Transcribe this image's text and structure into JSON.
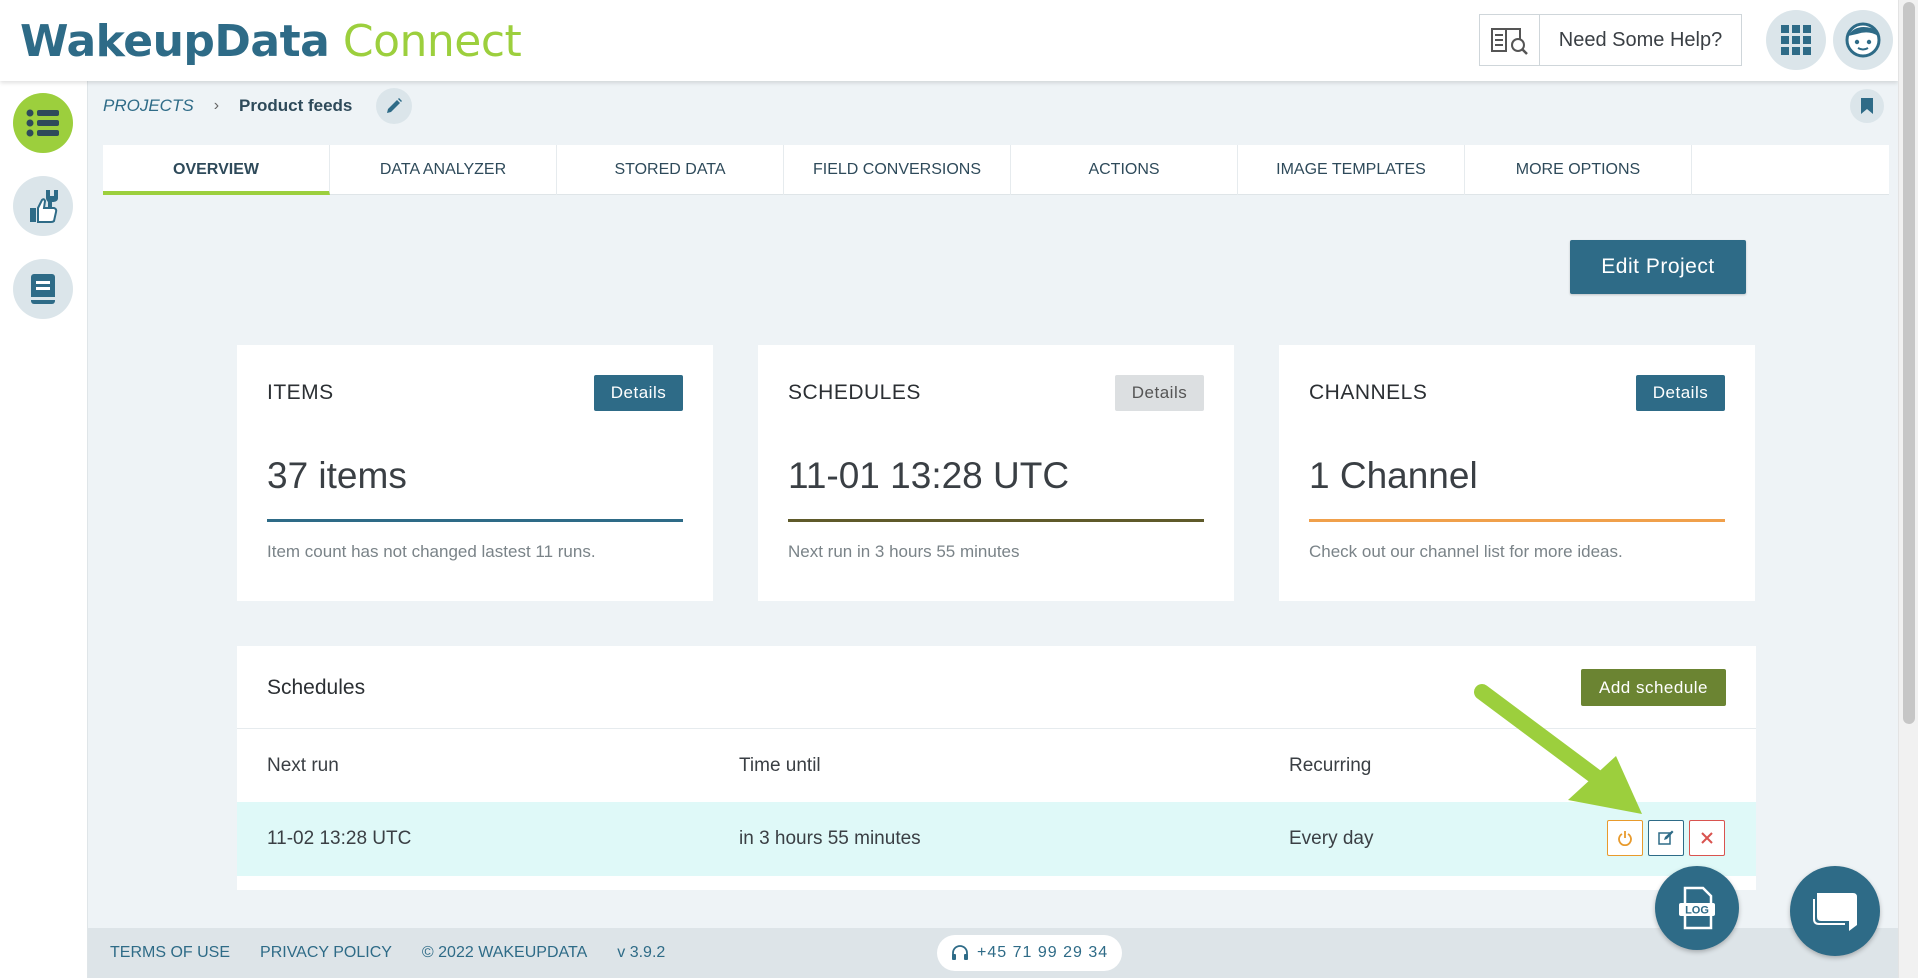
{
  "header": {
    "logo_part1": "WakeupData",
    "logo_part2": "Connect",
    "help_label": "Need Some Help?"
  },
  "breadcrumb": {
    "root": "PROJECTS",
    "separator": "›",
    "current": "Product feeds"
  },
  "tabs": [
    {
      "label": "OVERVIEW",
      "active": true
    },
    {
      "label": "DATA ANALYZER"
    },
    {
      "label": "STORED DATA"
    },
    {
      "label": "FIELD CONVERSIONS"
    },
    {
      "label": "ACTIONS"
    },
    {
      "label": "IMAGE TEMPLATES"
    },
    {
      "label": "MORE OPTIONS"
    }
  ],
  "edit_project_label": "Edit Project",
  "cards": [
    {
      "title": "ITEMS",
      "details": "Details",
      "value": "37 items",
      "note": "Item count has not changed lastest 11 runs.",
      "rule_color": "#2e6b87"
    },
    {
      "title": "SCHEDULES",
      "details": "Details",
      "value": "11-01 13:28 UTC",
      "note": "Next run in 3 hours 55 minutes",
      "rule_color": "#5f5a2a"
    },
    {
      "title": "CHANNELS",
      "details": "Details",
      "value": "1 Channel",
      "note": "Check out our channel list for more ideas.",
      "rule_color": "#f0a04b"
    }
  ],
  "schedules": {
    "title": "Schedules",
    "add_label": "Add schedule",
    "columns": [
      "Next run",
      "Time until",
      "Recurring"
    ],
    "rows": [
      {
        "next_run": "11-02 13:28 UTC",
        "time_until": "in 3 hours 55 minutes",
        "recurring": "Every day"
      }
    ]
  },
  "footer": {
    "terms": "TERMS OF USE",
    "privacy": "PRIVACY POLICY",
    "copyright": "© 2022 WAKEUPDATA",
    "version": "v 3.9.2",
    "phone": "+45 71 99 29 34"
  },
  "colors": {
    "brand_blue": "#2e6b87",
    "brand_green": "#9ccf3d",
    "add_schedule_green": "#6b8432",
    "row_highlight": "#dff9f8"
  },
  "icons": {
    "help": "book-search-icon",
    "apps": "grid-icon",
    "avatar": "face-icon",
    "rail1": "list-icon",
    "rail2": "tools-thumb-icon",
    "rail3": "book-icon",
    "edit": "pencil-icon",
    "bookmark": "bookmark-icon",
    "log": "log-file-icon",
    "chat": "chat-icon",
    "power": "power-icon",
    "edit_row": "edit-icon",
    "delete": "close-icon",
    "phone": "headset-icon"
  }
}
